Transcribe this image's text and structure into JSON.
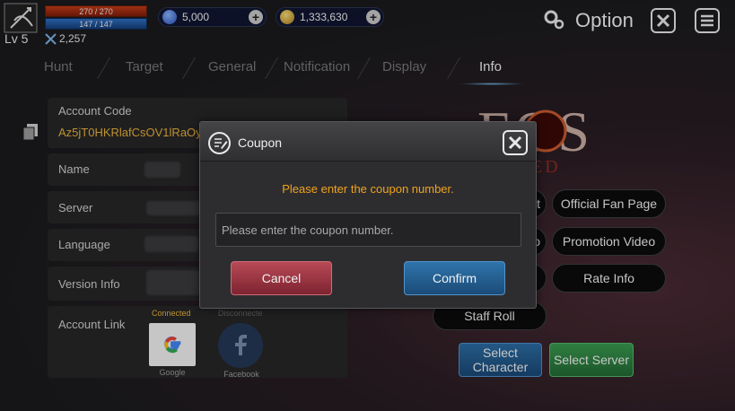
{
  "player": {
    "level": "Lv 5",
    "hp": "270 / 270",
    "mp": "147 / 147",
    "power": "2,257"
  },
  "currency": {
    "blue": "5,000",
    "gold": "1,333,630"
  },
  "header": {
    "title": "Option"
  },
  "tabs": [
    {
      "label": "Hunt"
    },
    {
      "label": "Target"
    },
    {
      "label": "General"
    },
    {
      "label": "Notification"
    },
    {
      "label": "Display"
    },
    {
      "label": "Info"
    }
  ],
  "info": {
    "account_code_label": "Account Code",
    "account_code_value": "Az5jT0HKRlafCsOV1lRaOy",
    "name_label": "Name",
    "server_label": "Server",
    "language_label": "Language",
    "version_label": "Version Info",
    "account_link_label": "Account Link",
    "google_status": "Connected",
    "facebook_status": "Disconnecte",
    "google_name": "Google",
    "facebook_name": "Facebook"
  },
  "right_buttons": {
    "partial1": "t",
    "partial2": "o",
    "fan_page": "Official Fan Page",
    "promo": "Promotion Video",
    "rate": "Rate Info",
    "staff": "Staff Roll",
    "select_character": "Select Character",
    "select_server": "Select Server"
  },
  "logo_text": "EOS",
  "logo_sub": "ED",
  "dialog": {
    "title": "Coupon",
    "message": "Please enter the coupon number.",
    "input_placeholder": "Please enter the coupon number.",
    "cancel": "Cancel",
    "confirm": "Confirm"
  },
  "colors": {
    "accent_gold": "#f0a21c",
    "cancel_red": "#9b3341",
    "confirm_blue": "#245e93",
    "server_green": "#2f8a45"
  }
}
